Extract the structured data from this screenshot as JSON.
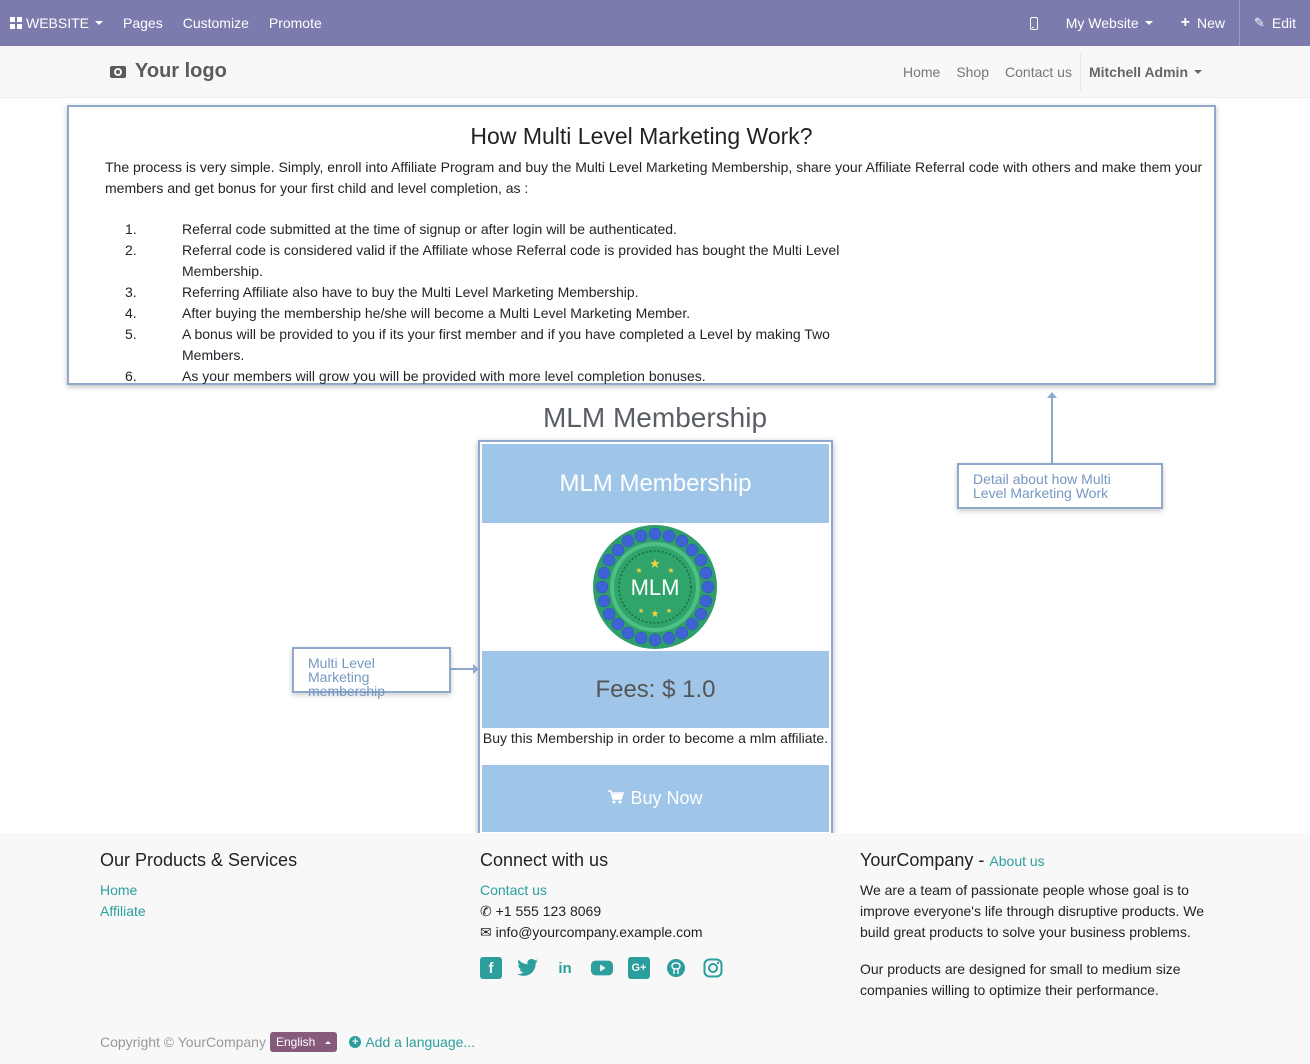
{
  "adminbar": {
    "app_label": "WEBSITE",
    "pages": "Pages",
    "customize": "Customize",
    "promote": "Promote",
    "website_select": "My Website",
    "new_label": "New",
    "edit_label": "Edit"
  },
  "header": {
    "logo_text": "Your logo",
    "nav": [
      "Home",
      "Shop",
      "Contact us"
    ],
    "user": "Mitchell Admin"
  },
  "info": {
    "title": "How Multi Level Marketing Work?",
    "intro": "The process is very simple. Simply, enroll into Affiliate Program and buy the Multi Level Marketing Membership, share your Affiliate Referral code with others and make them your members and get bonus for your first child and level completion, as :",
    "steps": [
      {
        "num": "1.",
        "text": "Referral code submitted at the time of signup or after login will be authenticated."
      },
      {
        "num": "2.",
        "text": "Referral code is considered valid if the Affiliate whose Referral code is provided has bought the Multi Level Membership."
      },
      {
        "num": "3.",
        "text": "Referring Affiliate also have to buy the Multi Level Marketing Membership."
      },
      {
        "num": "4.",
        "text": "After buying the membership he/she will become a Multi Level Marketing Member."
      },
      {
        "num": "5.",
        "text": "A bonus will be provided to you if its your first member and if you have completed a Level by making Two Members."
      },
      {
        "num": "6.",
        "text": "As your members will grow you will be provided with more level completion bonuses."
      }
    ]
  },
  "membership": {
    "section_title": "MLM Membership",
    "card_title": "MLM Membership",
    "badge_text": "MLM",
    "fees": "Fees: $ 1.0",
    "description": "Buy this Membership in order to become a mlm affiliate.",
    "buy_label": "Buy Now"
  },
  "callouts": {
    "right": "Detail about how Multi Level Marketing Work",
    "left": "Multi Level Marketing membership"
  },
  "footer": {
    "col1_title": "Our Products & Services",
    "col1_links": [
      "Home",
      "Affiliate"
    ],
    "col2_title": "Connect with us",
    "contact_link": "Contact us",
    "phone": "+1 555 123 8069",
    "email": "info@yourcompany.example.com",
    "social_icons": [
      "facebook-icon",
      "twitter-icon",
      "linkedin-icon",
      "youtube-icon",
      "google-plus-icon",
      "github-icon",
      "instagram-icon"
    ],
    "col3_title": "YourCompany",
    "col3_sep": " - ",
    "about_link": "About us",
    "about_p1": "We are a team of passionate people whose goal is to improve everyone's life through disruptive products. We build great products to solve your business problems.",
    "about_p2": "Our products are designed for small to medium size companies willing to optimize their performance.",
    "copyright": "Copyright © YourCompany",
    "language": "English",
    "add_language": "Add a language..."
  },
  "colors": {
    "adminbar": "#7c7bad",
    "card": "#9fc5e8",
    "link": "#2c9e9e",
    "callout_border": "#8fa8cc",
    "language_button": "#875a7b"
  }
}
